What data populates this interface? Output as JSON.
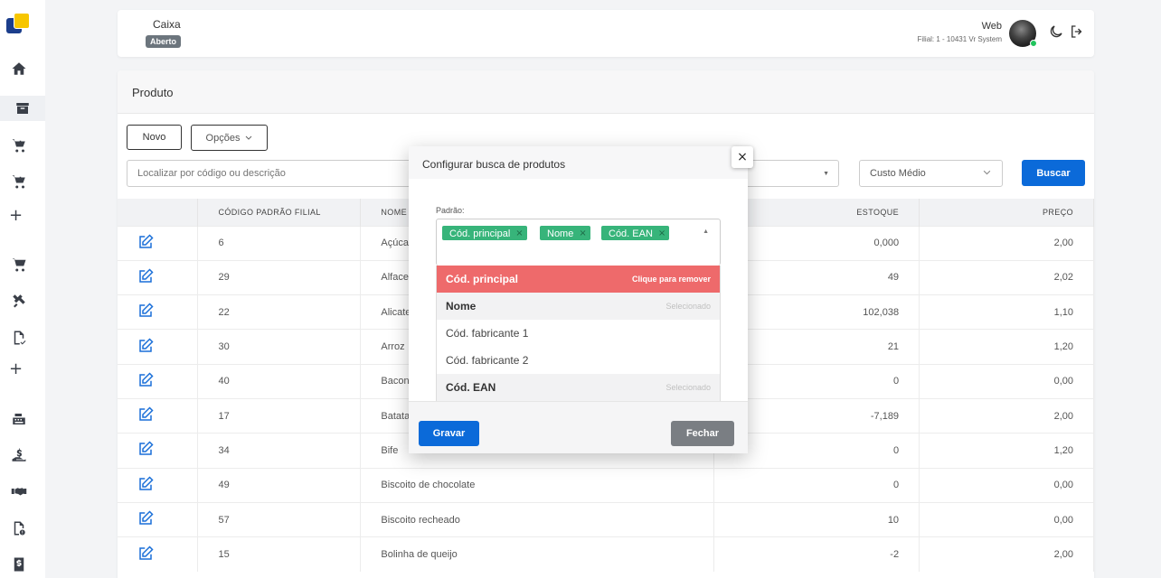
{
  "header": {
    "caixa_label": "Caixa",
    "caixa_status": "Aberto",
    "user_name": "Web",
    "user_filial": "Filial: 1 - 10431 Vr System"
  },
  "sidebar": {
    "icons": [
      "logo",
      "home-icon",
      "archive-icon",
      "cart-plus-icon",
      "cart-plus-icon",
      "plus-icon",
      "cart-icon",
      "tools-icon",
      "file-check-icon",
      "plus-icon",
      "cash-register-icon",
      "hand-dollar-icon",
      "handshake-icon",
      "file-alert-icon",
      "dollar-file-icon"
    ]
  },
  "page": {
    "title": "Produto",
    "novo_label": "Novo",
    "opcoes_label": "Opções",
    "search_placeholder": "Localizar por código ou descrição",
    "custo_label": "Custo Médio",
    "buscar_label": "Buscar"
  },
  "table": {
    "headers": [
      "",
      "CÓDIGO PADRÃO FILIAL",
      "NOME",
      "ESTOQUE",
      "PREÇO"
    ],
    "rows": [
      {
        "code": "6",
        "name": "Açúcar",
        "stock": "0,000",
        "price": "2,00"
      },
      {
        "code": "29",
        "name": "Alface",
        "stock": "49",
        "price": "2,02"
      },
      {
        "code": "22",
        "name": "Alicate",
        "stock": "102,038",
        "price": "1,10"
      },
      {
        "code": "30",
        "name": "Arroz",
        "stock": "21",
        "price": "1,20"
      },
      {
        "code": "40",
        "name": "Bacon",
        "stock": "0",
        "price": "0,00"
      },
      {
        "code": "17",
        "name": "Batata",
        "stock": "-7,189",
        "price": "2,00"
      },
      {
        "code": "34",
        "name": "Bife",
        "stock": "0",
        "price": "1,20"
      },
      {
        "code": "49",
        "name": "Biscoito de chocolate",
        "stock": "0",
        "price": "0,00"
      },
      {
        "code": "57",
        "name": "Biscoito recheado",
        "stock": "10",
        "price": "0,00"
      },
      {
        "code": "15",
        "name": "Bolinha de queijo",
        "stock": "-2",
        "price": "2,00"
      }
    ]
  },
  "modal": {
    "title": "Configurar busca de produtos",
    "close_symbol": "×",
    "padrao_label": "Padrão:",
    "tags": [
      "Cód. principal",
      "Nome",
      "Cód. EAN"
    ],
    "tag_remove_symbol": "×",
    "options": [
      {
        "label": "Cód. principal",
        "hint": "Clique para remover",
        "state": "remove"
      },
      {
        "label": "Nome",
        "hint": "Selecionado",
        "state": "selected"
      },
      {
        "label": "Cód. fabricante 1",
        "hint": "",
        "state": "none"
      },
      {
        "label": "Cód. fabricante 2",
        "hint": "",
        "state": "none"
      },
      {
        "label": "Cód. EAN",
        "hint": "Selecionado",
        "state": "selected"
      }
    ],
    "gravar_label": "Gravar",
    "fechar_label": "Fechar"
  },
  "colors": {
    "primary": "#0b6ad9",
    "tag_green": "#37b47a",
    "remove_red": "#ee6a6b",
    "status_gray": "#6c757d",
    "online_green": "#22c55e"
  }
}
